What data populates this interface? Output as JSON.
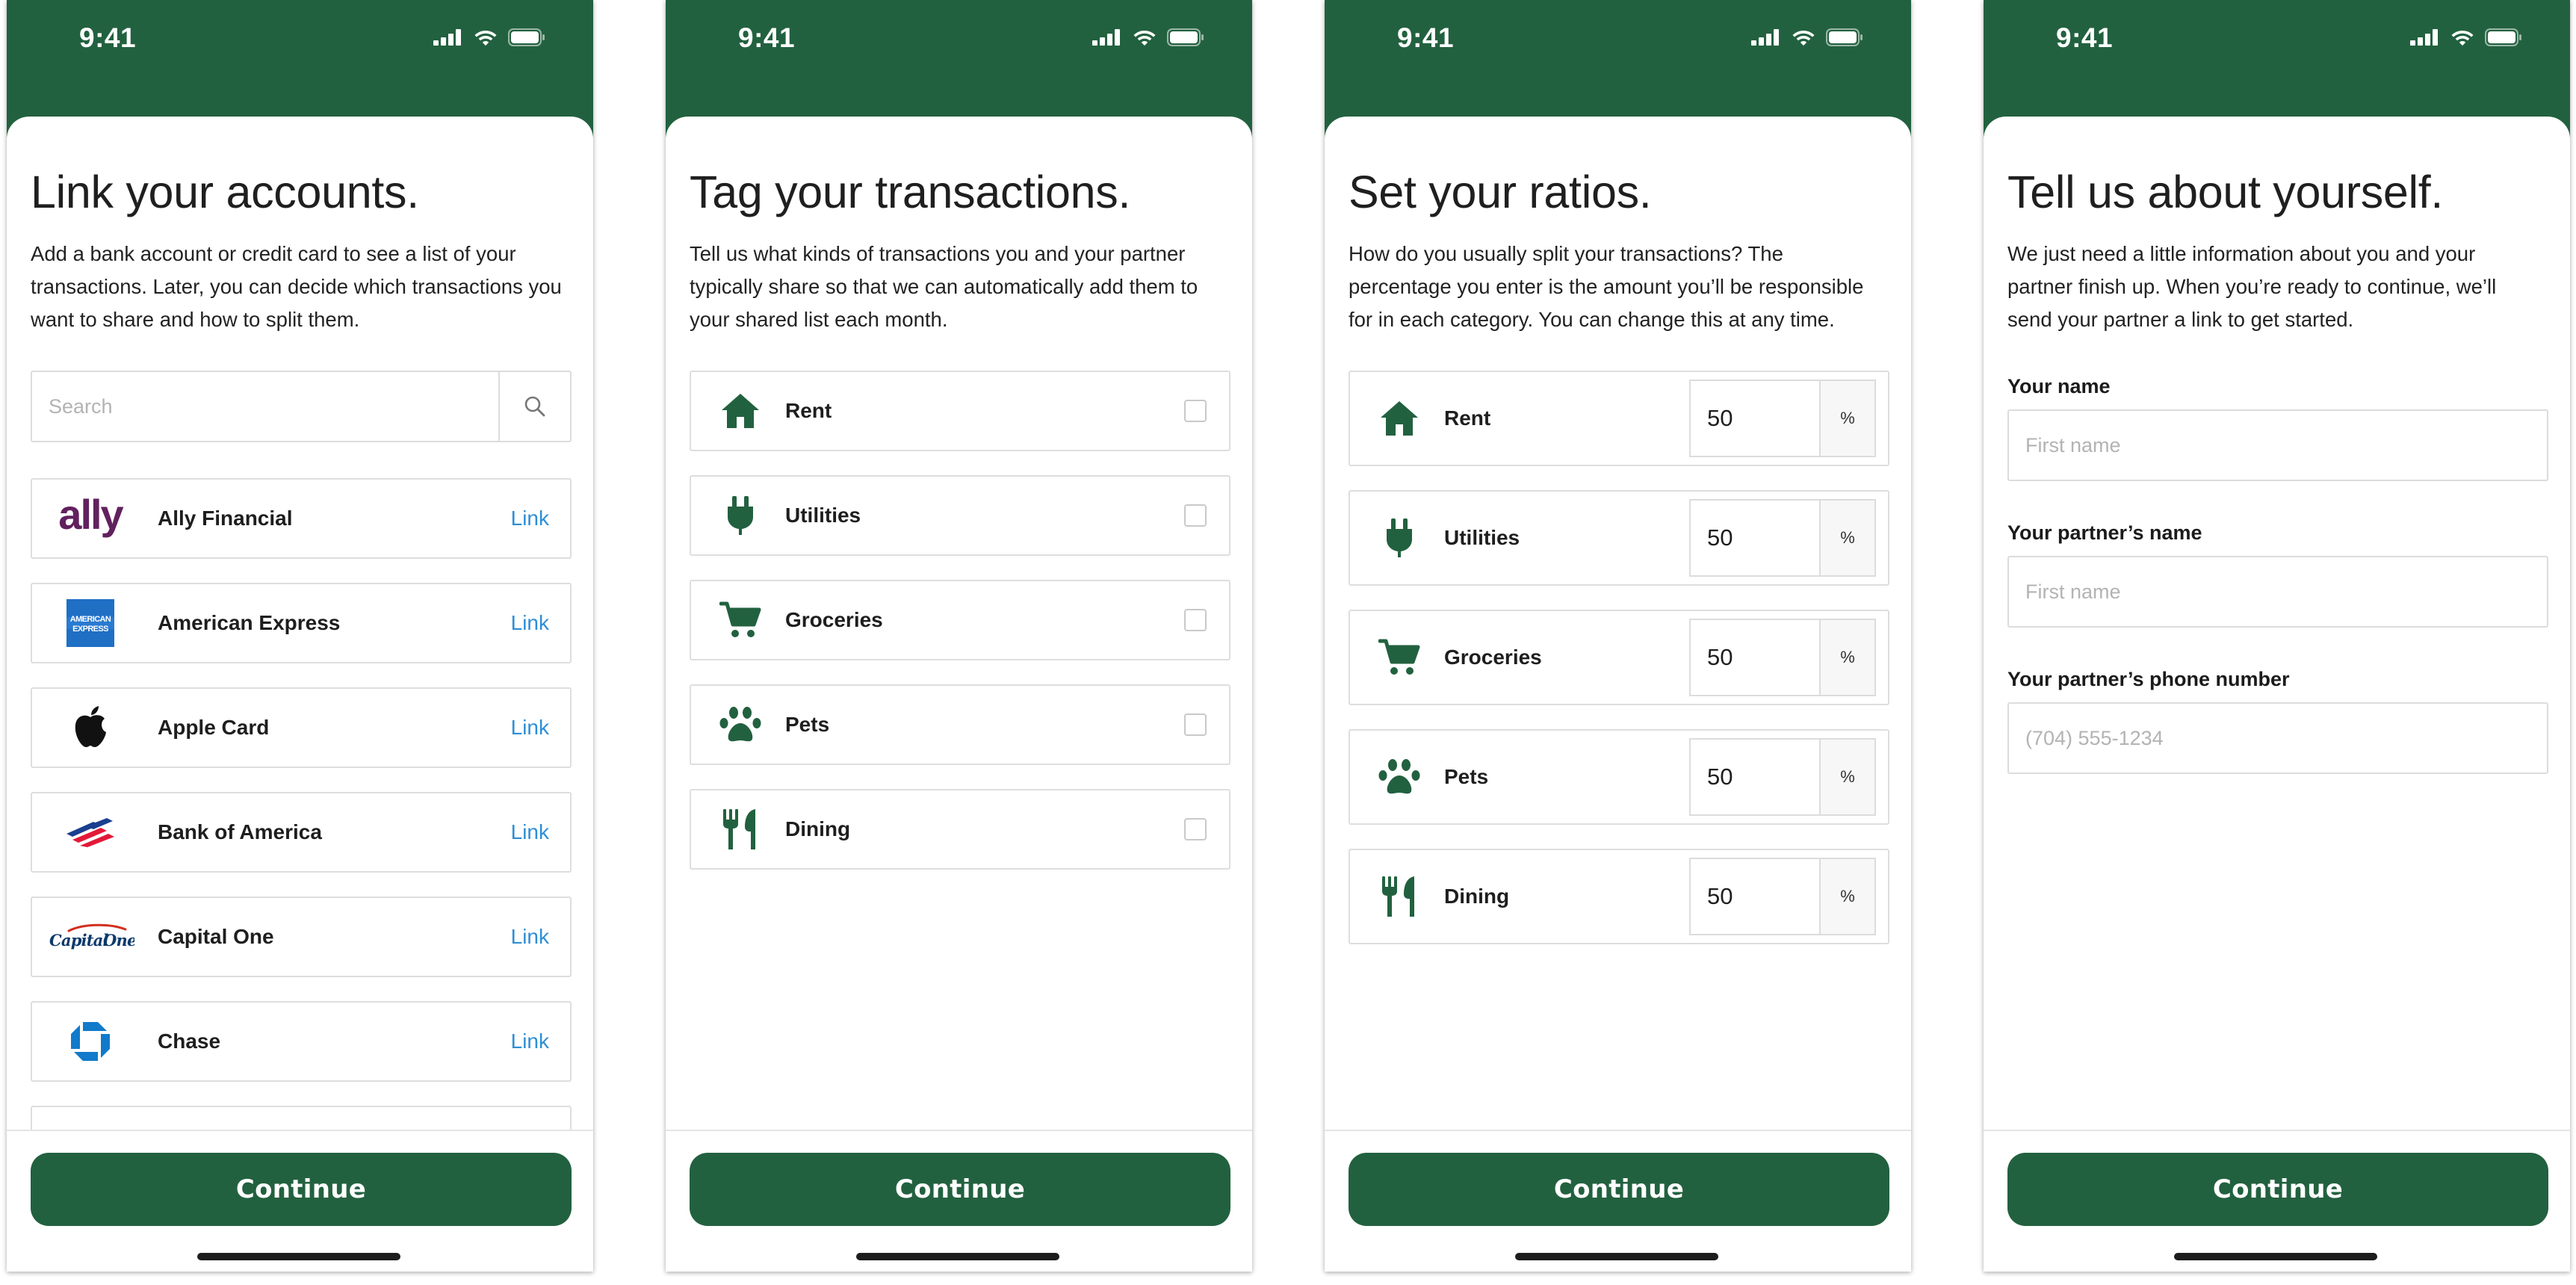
{
  "colors": {
    "brand": "#22613f",
    "link": "#2d8ed6",
    "border": "#dcdcdc"
  },
  "status_bar": {
    "time": "9:41"
  },
  "screens": [
    {
      "title": "Link your accounts.",
      "description": "Add a bank account or credit card to see a list of your transactions. Later, you can decide which transactions you want to share and how to split them.",
      "search": {
        "placeholder": "Search",
        "value": ""
      },
      "banks": [
        {
          "name": "Ally Financial",
          "logo": "ally-logo",
          "logo_text": "ally",
          "action": "Link"
        },
        {
          "name": "American Express",
          "logo": "amex-logo",
          "logo_text": "AMERICAN EXPRESS",
          "action": "Link"
        },
        {
          "name": "Apple Card",
          "logo": "apple-logo",
          "action": "Link"
        },
        {
          "name": "Bank of America",
          "logo": "bank-of-america-logo",
          "action": "Link"
        },
        {
          "name": "Capital One",
          "logo": "capital-one-logo",
          "logo_text": "Capital One",
          "action": "Link"
        },
        {
          "name": "Chase",
          "logo": "chase-logo",
          "action": "Link"
        }
      ],
      "continue_label": "Continue"
    },
    {
      "title": "Tag your transactions.",
      "description": "Tell us what kinds of transactions you and your partner typically share so that we can automatically add them to your shared list each month.",
      "categories": [
        {
          "label": "Rent",
          "icon": "house-icon",
          "checked": false
        },
        {
          "label": "Utilities",
          "icon": "plug-icon",
          "checked": false
        },
        {
          "label": "Groceries",
          "icon": "cart-icon",
          "checked": false
        },
        {
          "label": "Pets",
          "icon": "paw-icon",
          "checked": false
        },
        {
          "label": "Dining",
          "icon": "utensils-icon",
          "checked": false
        }
      ],
      "continue_label": "Continue"
    },
    {
      "title": "Set your ratios.",
      "description": "How do you usually split your transactions? The percentage you enter is the amount you’ll be responsible for in each category. You can change this at any time.",
      "ratios": [
        {
          "label": "Rent",
          "icon": "house-icon",
          "value": "50",
          "unit": "%"
        },
        {
          "label": "Utilities",
          "icon": "plug-icon",
          "value": "50",
          "unit": "%"
        },
        {
          "label": "Groceries",
          "icon": "cart-icon",
          "value": "50",
          "unit": "%"
        },
        {
          "label": "Pets",
          "icon": "paw-icon",
          "value": "50",
          "unit": "%"
        },
        {
          "label": "Dining",
          "icon": "utensils-icon",
          "value": "50",
          "unit": "%"
        }
      ],
      "continue_label": "Continue"
    },
    {
      "title": "Tell us about yourself.",
      "description": "We just need a little information about you and your partner finish up. When you’re ready to continue, we’ll send your partner a link to get started.",
      "fields": [
        {
          "label": "Your name",
          "placeholder": "First name",
          "value": ""
        },
        {
          "label": "Your partner’s name",
          "placeholder": "First name",
          "value": ""
        },
        {
          "label": "Your partner’s phone number",
          "placeholder": "(704) 555-1234",
          "value": ""
        }
      ],
      "continue_label": "Continue"
    }
  ]
}
